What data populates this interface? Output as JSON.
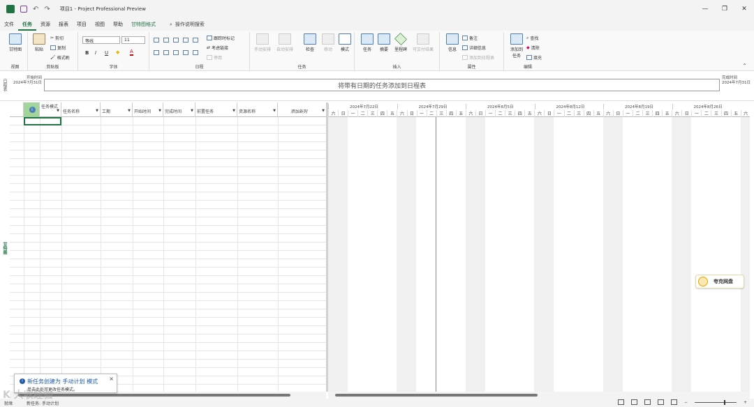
{
  "titlebar": {
    "title": "项目1  -  Project Professional Preview"
  },
  "menu": {
    "tabs": [
      "文件",
      "任务",
      "资源",
      "报表",
      "项目",
      "视图",
      "帮助",
      "甘特图格式"
    ],
    "active_index": 1,
    "search": "操作说明搜索"
  },
  "ribbon": {
    "view": {
      "gantt": "甘特图",
      "label": "视图"
    },
    "clipboard": {
      "paste": "粘贴",
      "cut": "剪切",
      "copy": "复制",
      "painter": "格式刷",
      "label": "剪贴板"
    },
    "font": {
      "name": "等线",
      "size": "11",
      "bold": "B",
      "italic": "I",
      "underline": "U",
      "label": "字体"
    },
    "schedule": {
      "mark_on_track": "跟踪时标记",
      "respect_links": "考虑链接",
      "inactivate": "停用",
      "label": "日程",
      "pcts": [
        "0%",
        "25%",
        "50%",
        "75%",
        "100%"
      ]
    },
    "tasks": {
      "manual": "手动安排",
      "auto": "自动安排",
      "inspect": "检查",
      "move": "移动",
      "mode": "模式",
      "label": "任务"
    },
    "insert": {
      "task": "任务",
      "summary": "摘要",
      "milestone": "里程碑",
      "deliverable": "可交付结果",
      "label": "插入"
    },
    "properties": {
      "info": "信息",
      "notes": "备注",
      "details": "详细信息",
      "add_timeline": "添加到日程表",
      "label": "属性"
    },
    "editing": {
      "add_to_timeline": "添加到",
      "add_to_timeline2": "任务",
      "find": "查找",
      "clear": "清除",
      "fill": "填充",
      "label": "编辑"
    }
  },
  "timeline": {
    "side_label": "日程表",
    "start_label": "开始时间",
    "start_date": "2024年7月31日",
    "placeholder": "将带有日期的任务添加到日程表",
    "end_label": "完成时间",
    "end_date": "2024年7月31日"
  },
  "grid": {
    "side_label": "甘特图",
    "columns": [
      "任务模式",
      "任务名称",
      "工期",
      "开始时间",
      "完成时间",
      "前置任务",
      "资源名称",
      "添加新列"
    ]
  },
  "gantt": {
    "weeks": [
      "2024年7月22日",
      "2024年7月29日",
      "2024年8月5日",
      "2024年8月12日",
      "2024年8月19日",
      "2024年8月26日"
    ],
    "day_labels": [
      "六",
      "日",
      "一",
      "二",
      "三",
      "四",
      "五"
    ]
  },
  "popup": {
    "title": "新任务创建为 手动计划 模式",
    "body": "单击此处可更改任务模式。"
  },
  "cloud": {
    "label": "夸克网盘"
  },
  "status": {
    "ready": "就绪",
    "task_mode": "新任务: 手动计划"
  },
  "watermark": "K  大收经验"
}
